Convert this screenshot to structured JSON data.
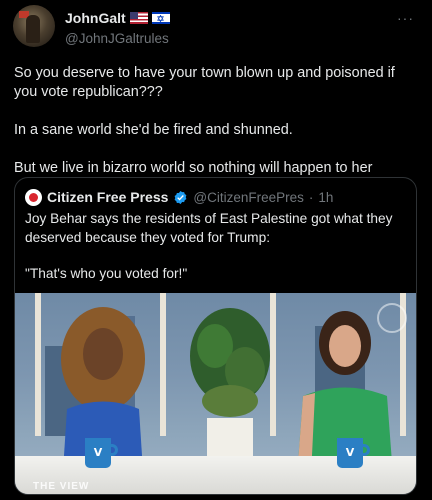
{
  "author": {
    "display_name": "JohnGalt",
    "handle": "@JohnJGaltrules",
    "flags": [
      "us-flag-icon",
      "israel-flag-icon"
    ]
  },
  "more_label": "···",
  "tweet": {
    "paragraphs": [
      "So you deserve to have your town blown up and poisoned if you vote republican???",
      "In a sane world she'd be fired and shunned.",
      "But we live in bizarro world so nothing will happen to her"
    ]
  },
  "quote": {
    "display_name": "Citizen Free Press",
    "handle": "@CitizenFreePres",
    "separator": "·",
    "time": "1h",
    "paragraphs": [
      "Joy Behar says the residents of East Palestine got what they deserved because they voted for Trump:",
      "\"That's who you voted for!\""
    ],
    "media": {
      "mug_label": "V",
      "show_logo": "THE VIEW"
    }
  },
  "colors": {
    "background": "#000000",
    "text": "#e7e9ea",
    "muted": "#71767b",
    "border": "#2f3336",
    "verified": "#1d9bf0"
  }
}
